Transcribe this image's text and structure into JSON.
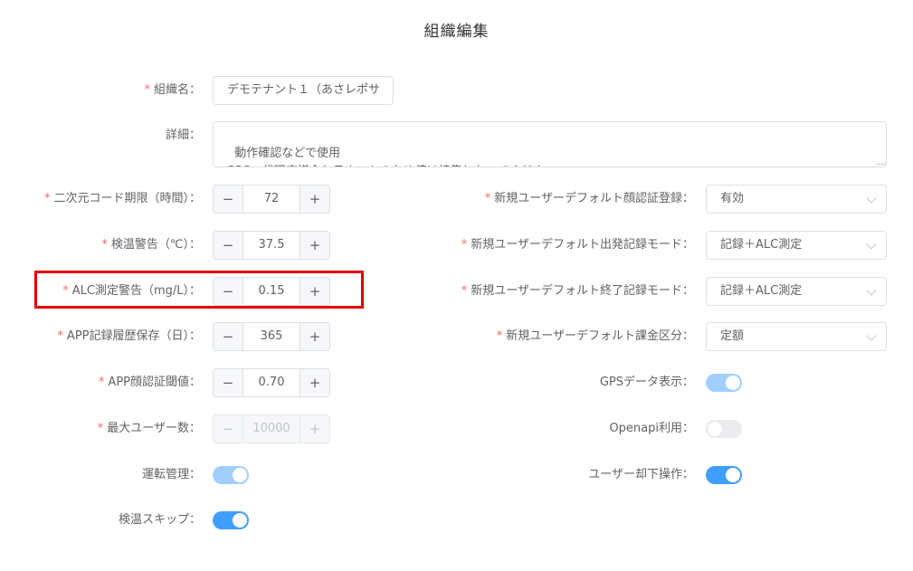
{
  "page": {
    "title": "組織編集"
  },
  "form": {
    "org_name": {
      "label": "組織名：",
      "required": true,
      "value": "デモテナント１（あさレポサ"
    },
    "detail": {
      "label": "詳細：",
      "required": false,
      "value": "動作確認などで使用\nSSC、代理店様含むテナントのため値は編集しないでください。"
    },
    "qr_expiry": {
      "label": "二次元コード期限（時間）：",
      "required": true,
      "value": "72"
    },
    "temp_warning": {
      "label": "検温警告（℃）：",
      "required": true,
      "value": "37.5"
    },
    "alc_warning": {
      "label": "ALC測定警告（mg/L）：",
      "required": true,
      "value": "0.15"
    },
    "app_history": {
      "label": "APP記録履歴保存（日）：",
      "required": true,
      "value": "365"
    },
    "app_face_threshold": {
      "label": "APP顔認証閾値：",
      "required": true,
      "value": "0.70"
    },
    "max_users": {
      "label": "最大ユーザー数：",
      "required": true,
      "value": "10000",
      "disabled": true
    },
    "driving_mgmt": {
      "label": "運転管理：",
      "required": false,
      "state": "on",
      "disabled": true
    },
    "temp_skip": {
      "label": "検温スキップ：",
      "required": false,
      "state": "on"
    },
    "new_user_face_reg": {
      "label": "新規ユーザーデフォルト顔認証登録：",
      "required": true,
      "value": "有効"
    },
    "new_user_depart_mode": {
      "label": "新規ユーザーデフォルト出発記録モード：",
      "required": true,
      "value": "記録＋ALC測定"
    },
    "new_user_end_mode": {
      "label": "新規ユーザーデフォルト終了記録モード：",
      "required": true,
      "value": "記録＋ALC測定"
    },
    "new_user_billing": {
      "label": "新規ユーザーデフォルト課金区分：",
      "required": true,
      "value": "定額"
    },
    "gps_display": {
      "label": "GPSデータ表示：",
      "required": false,
      "state": "on",
      "disabled": true
    },
    "openapi": {
      "label": "Openapi利用：",
      "required": false,
      "state": "off",
      "disabled": true
    },
    "user_reject": {
      "label": "ユーザー却下操作：",
      "required": false,
      "state": "on"
    }
  },
  "controls": {
    "minus": "−",
    "plus": "+",
    "required_mark": "*"
  },
  "colors": {
    "accent": "#409eff",
    "required": "#f56c6c",
    "highlight": "#e00000"
  },
  "icons": {
    "select_arrow": "chevron-down-icon"
  }
}
